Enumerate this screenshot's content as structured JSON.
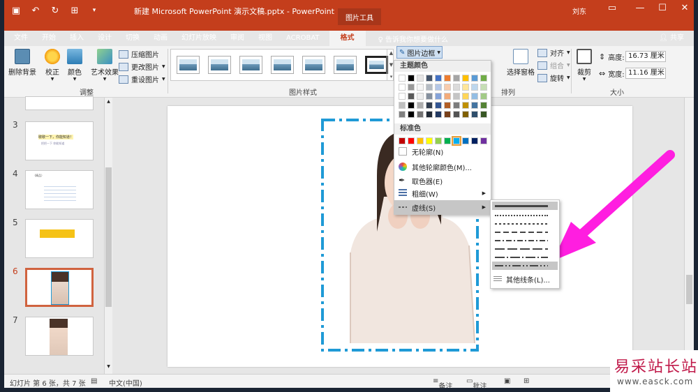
{
  "window": {
    "doc_title": "新建 Microsoft PowerPoint 演示文稿.pptx  -  PowerPoint",
    "context_tool": "图片工具",
    "user": "刘东"
  },
  "tabs": [
    {
      "label": "文件"
    },
    {
      "label": "开始"
    },
    {
      "label": "插入"
    },
    {
      "label": "设计"
    },
    {
      "label": "切换"
    },
    {
      "label": "动画"
    },
    {
      "label": "幻灯片放映"
    },
    {
      "label": "审阅"
    },
    {
      "label": "视图"
    },
    {
      "label": "ACROBAT"
    },
    {
      "label": "格式"
    }
  ],
  "tell_me": "告诉我你想要做什么",
  "share": "共享",
  "ribbon": {
    "remove_bg": "删除背景",
    "correct": "校正",
    "color": "颜色",
    "artistic": "艺术效果",
    "compress": "压缩图片",
    "change": "更改图片",
    "reset": "重设图片",
    "group_adjust": "调整",
    "group_styles": "图片样式",
    "border": "图片边框",
    "align": "对齐",
    "combine": "组合",
    "rotate": "旋转",
    "select_pane": "选择窗格",
    "group_arrange": "排列",
    "crop": "裁剪",
    "height_label": "高度:",
    "height_value": "16.73 厘米",
    "width_label": "宽度:",
    "width_value": "11.16 厘米",
    "group_size": "大小"
  },
  "slides": [
    {
      "num": "3",
      "title": "歇歇一下，你能知道！",
      "sub": "把把一下 你能知道"
    },
    {
      "num": "4",
      "title": "（精品）"
    },
    {
      "num": "5"
    },
    {
      "num": "6"
    },
    {
      "num": "7"
    }
  ],
  "menu": {
    "theme_colors": "主题颜色",
    "standard_colors": "标准色",
    "no_outline": "无轮廓(N)",
    "more_colors": "其他轮廓颜色(M)...",
    "eyedropper": "取色器(E)",
    "weight": "粗细(W)",
    "dashes": "虚线(S)",
    "more_lines": "其他线条(L)..."
  },
  "status": {
    "slide_info": "幻灯片 第 6 张，共 7 张",
    "language": "中文(中国)",
    "notes": "备注",
    "comments": "批注"
  },
  "watermark": {
    "title": "易采站长站",
    "url": "www.easck.com"
  },
  "colors": {
    "accent": "#c43e1c",
    "dash_border": "#1f9ad6",
    "arrow": "#ff1ee0"
  }
}
